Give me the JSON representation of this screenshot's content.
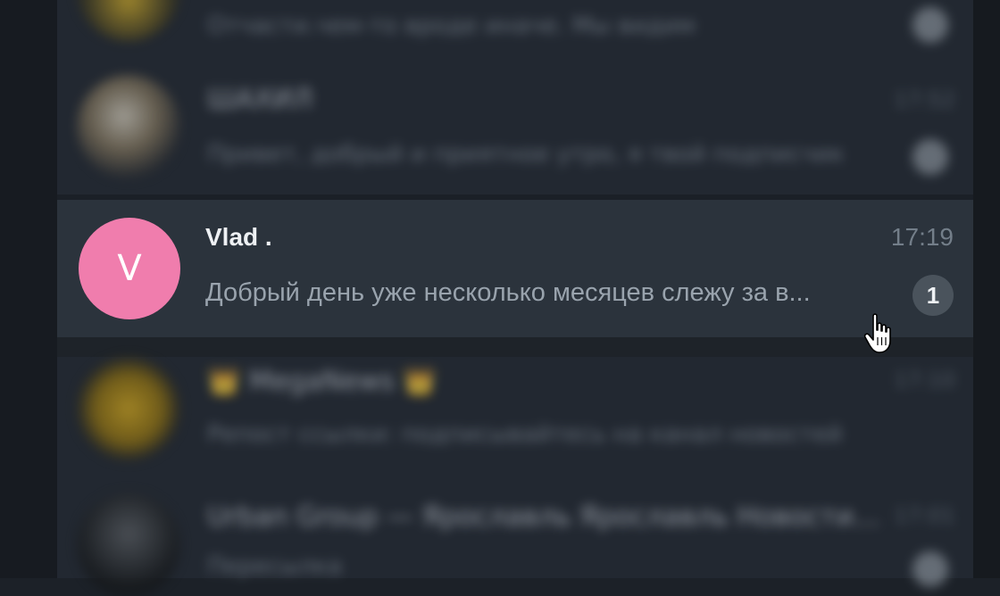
{
  "chats": [
    {
      "preview": "Отчасти.чем-то вроде иначе. Мы видим",
      "state": "blurred",
      "has_badge": true
    },
    {
      "title": "ШАХИЛ",
      "time": "17:52",
      "preview": "Привет, добрый и приятное утро, я твой подписчик",
      "state": "blurred",
      "has_badge": true
    },
    {
      "name": "Vlad .",
      "avatar_initial": "V",
      "avatar_color": "#f07dad",
      "time": "17:19",
      "preview": "Добрый день уже несколько месяцев слежу за в...",
      "unread_count": "1",
      "state": "hovered"
    },
    {
      "title": "👑 MegaNews 👑",
      "time": "17:10",
      "preview": "Репост ссылки: подписывайтесь на канал новостей",
      "state": "blurred"
    },
    {
      "title": "Urban Group — Ярославль Ярославль Новости…",
      "time": "17:01",
      "preview": "Пересылка",
      "state": "blurred",
      "has_badge": true
    }
  ],
  "colors": {
    "list_bg": "#222831",
    "hover_bg": "#2b333c",
    "badge_bg": "#4a535c",
    "avatar_v": "#f07dad"
  },
  "icons": {
    "cursor": "hand-pointer-icon"
  }
}
